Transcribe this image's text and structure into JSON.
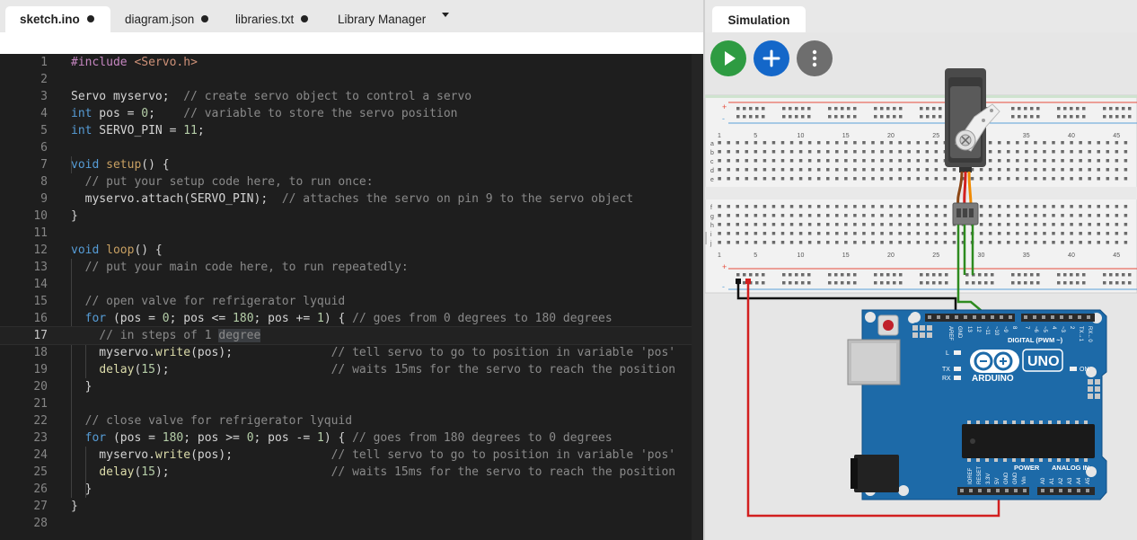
{
  "tabs": [
    {
      "label": "sketch.ino",
      "modified": true
    },
    {
      "label": "diagram.json",
      "modified": true
    },
    {
      "label": "libraries.txt",
      "modified": true
    },
    {
      "label": "Library Manager",
      "modified": false
    }
  ],
  "editor": {
    "current_line": 17,
    "line_numbers": [
      "1",
      "2",
      "3",
      "4",
      "5",
      "6",
      "7",
      "8",
      "9",
      "10",
      "11",
      "12",
      "13",
      "14",
      "15",
      "16",
      "17",
      "18",
      "19",
      "20",
      "21",
      "22",
      "23",
      "24",
      "25",
      "26",
      "27",
      "28"
    ],
    "lines": [
      "#include <Servo.h>",
      "",
      "Servo myservo;  // create servo object to control a servo",
      "int pos = 0;    // variable to store the servo position",
      "int SERVO_PIN = 11;",
      "",
      "void setup() {",
      "  // put your setup code here, to run once:",
      "  myservo.attach(SERVO_PIN);  // attaches the servo on pin 9 to the servo object",
      "}",
      "",
      "void loop() {",
      "  // put your main code here, to run repeatedly:",
      "",
      "  // open valve for refrigerator lyquid",
      "  for (pos = 0; pos <= 180; pos += 1) { // goes from 0 degrees to 180 degrees",
      "    // in steps of 1 degree",
      "    myservo.write(pos);              // tell servo to go to position in variable 'pos'",
      "    delay(15);                       // waits 15ms for the servo to reach the position",
      "  }",
      "",
      "  // close valve for refrigerator lyquid",
      "  for (pos = 180; pos >= 0; pos -= 1) { // goes from 180 degrees to 0 degrees",
      "    myservo.write(pos);              // tell servo to go to position in variable 'pos'",
      "    delay(15);                       // waits 15ms for the servo to reach the position",
      "  }",
      "}",
      ""
    ]
  },
  "simulation": {
    "tab_label": "Simulation",
    "buttons": {
      "run": "play-icon",
      "add": "plus-icon",
      "more": "more-vertical-icon"
    },
    "breadboard": {
      "column_labels": [
        "1",
        "5",
        "10",
        "15",
        "20",
        "25",
        "30",
        "35",
        "40",
        "45"
      ],
      "row_labels_top": [
        "a",
        "b",
        "c",
        "d",
        "e"
      ],
      "row_labels_bottom": [
        "f",
        "g",
        "h",
        "i",
        "j"
      ]
    },
    "arduino": {
      "logo_text": "ARDUINO",
      "model": "UNO",
      "digital_label": "DIGITAL (PWM ~)",
      "power_label": "POWER",
      "analog_label": "ANALOG IN",
      "on_label": "ON",
      "l_label": "L",
      "tx_label": "TX",
      "rx_label": "RX",
      "top_pins": [
        "AREF",
        "GND",
        "13",
        "12",
        "~11",
        "~10",
        "~9",
        "8",
        "7",
        "~6",
        "~5",
        "4",
        "~3",
        "2",
        "TX→1",
        "RX←0"
      ],
      "power_pins": [
        "IOREF",
        "RESET",
        "3.3V",
        "5V",
        "GND",
        "GND",
        "Vin"
      ],
      "analog_pins": [
        "A0",
        "A1",
        "A2",
        "A3",
        "A4",
        "A5"
      ]
    },
    "colors": {
      "run": "#2e9b42",
      "add": "#1467c9",
      "more": "#6e6e6e",
      "board": "#1d6aa8",
      "wire_red": "#d21f1f",
      "wire_black": "#111111",
      "wire_green": "#2e8b1f",
      "servo_wire_orange": "#f08a00"
    }
  }
}
